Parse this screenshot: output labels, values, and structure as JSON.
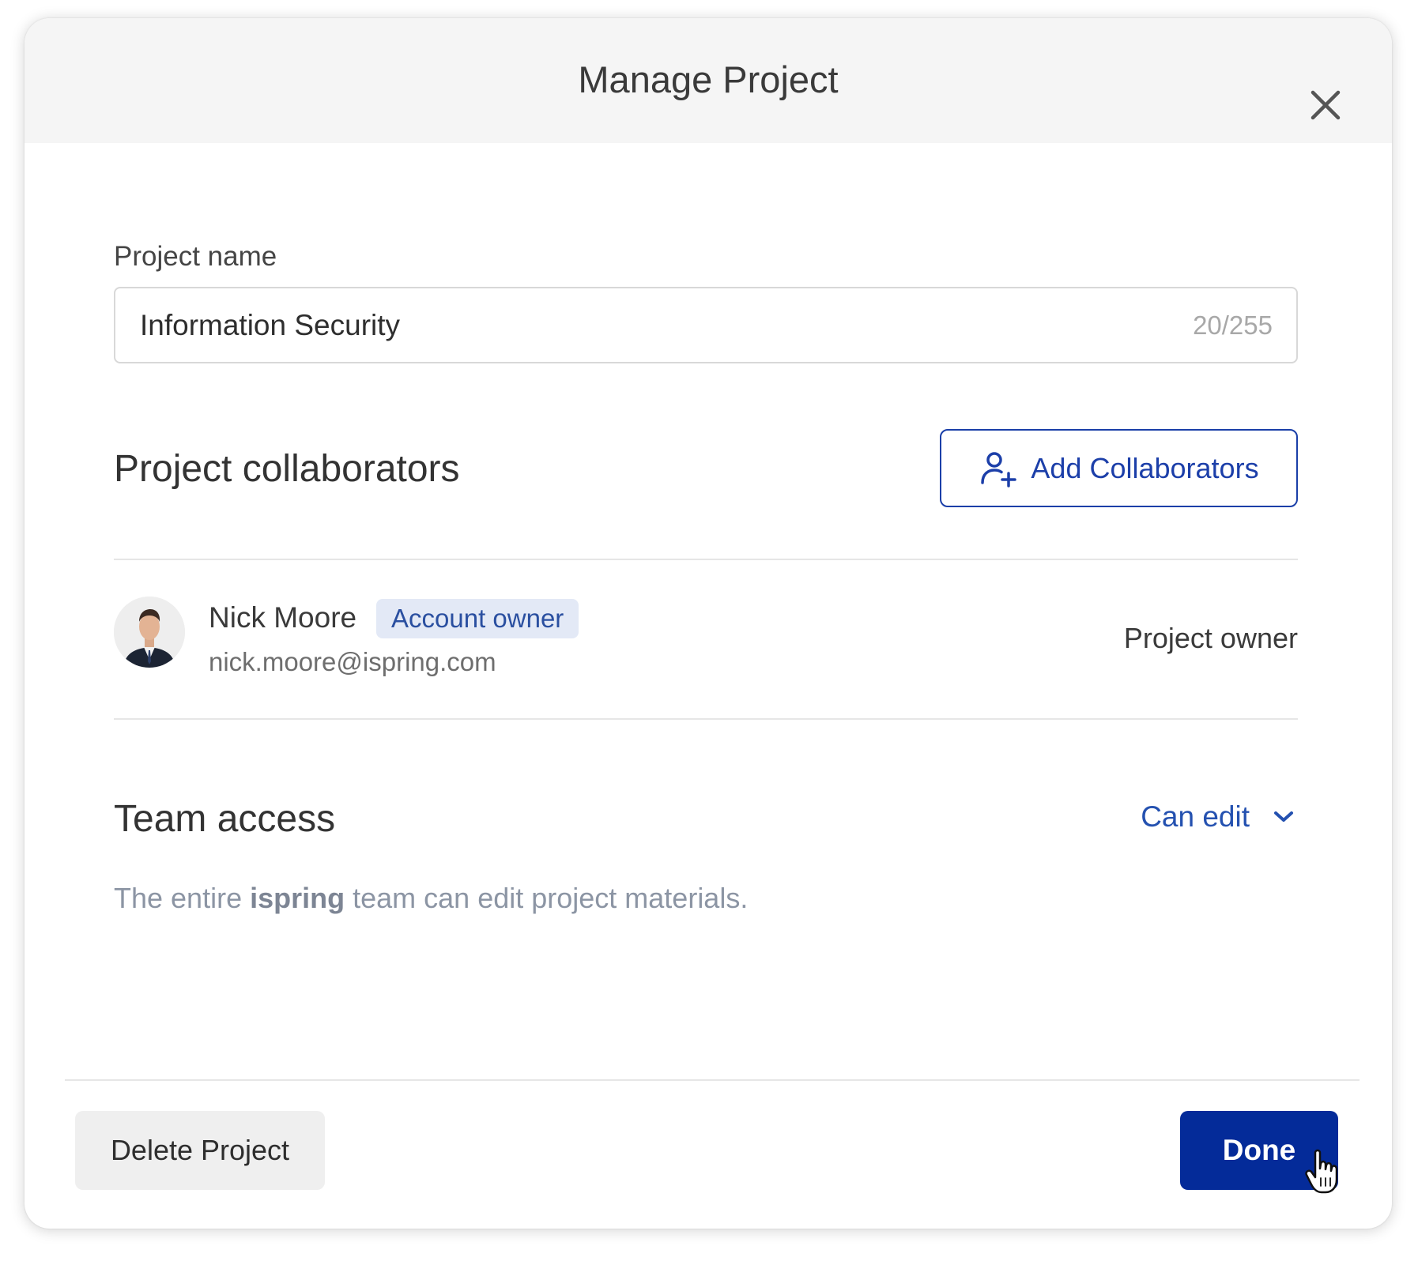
{
  "dialog": {
    "title": "Manage Project",
    "close_icon": "close-icon"
  },
  "project_name": {
    "label": "Project name",
    "value": "Information Security",
    "counter": "20/255"
  },
  "collaborators": {
    "title": "Project collaborators",
    "add_button_label": "Add Collaborators",
    "add_icon": "add-user-icon",
    "items": [
      {
        "name": "Nick Moore",
        "badge": "Account owner",
        "email": "nick.moore@ispring.com",
        "role": "Project owner"
      }
    ]
  },
  "team_access": {
    "title": "Team access",
    "selected": "Can edit",
    "description_prefix": "The entire ",
    "team_name": "ispring",
    "description_suffix": " team can edit project materials."
  },
  "footer": {
    "delete_label": "Delete Project",
    "done_label": "Done"
  },
  "colors": {
    "accent": "#1c3fa9",
    "primary_button": "#042b99",
    "header_bg": "#f5f5f5",
    "badge_bg": "#e3e9f6"
  }
}
